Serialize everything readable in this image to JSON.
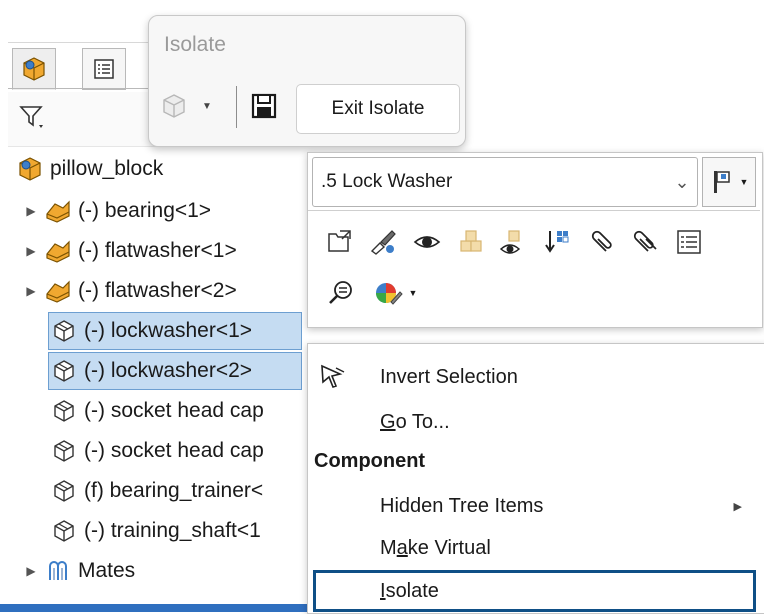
{
  "tree": {
    "root": {
      "label": "pillow_block",
      "icon": "assembly-icon"
    },
    "items": [
      {
        "label": "(-) bearing<1>",
        "icon": "subassembly-icon",
        "expandable": true,
        "selected": false
      },
      {
        "label": "(-) flatwasher<1>",
        "icon": "subassembly-icon",
        "expandable": true,
        "selected": false
      },
      {
        "label": "(-) flatwasher<2>",
        "icon": "subassembly-icon",
        "expandable": true,
        "selected": false
      },
      {
        "label": "(-) lockwasher<1>",
        "icon": "part-icon",
        "expandable": false,
        "selected": true
      },
      {
        "label": "(-) lockwasher<2>",
        "icon": "part-icon",
        "expandable": false,
        "selected": true
      },
      {
        "label": "(-) socket head cap",
        "icon": "part-icon",
        "expandable": false,
        "selected": false
      },
      {
        "label": "(-) socket head cap",
        "icon": "part-icon",
        "expandable": false,
        "selected": false
      },
      {
        "label": "(f) bearing_trainer<",
        "icon": "part-icon",
        "expandable": false,
        "selected": false
      },
      {
        "label": "(-) training_shaft<1",
        "icon": "part-icon",
        "expandable": false,
        "selected": false
      },
      {
        "label": "Mates",
        "icon": "mates-icon",
        "expandable": true,
        "selected": false
      }
    ]
  },
  "isolate_popup": {
    "title": "Isolate",
    "exit_label": "Exit Isolate"
  },
  "context_toolbar": {
    "selected_component": ".5 Lock Washer",
    "tools": [
      "open-part-icon",
      "edit-part-icon",
      "show-hide-eye-icon",
      "transparency-icon",
      "hide-others-icon",
      "insert-arrow-icon",
      "paperclip-icon",
      "multi-paperclip-icon",
      "properties-icon",
      "zoom-to-selection-icon",
      "appearance-icon"
    ]
  },
  "context_menu": {
    "invert_selection": "Invert Selection",
    "go_to": {
      "before": "",
      "key": "G",
      "after": "o To..."
    },
    "section_component": "Component",
    "hidden_tree_items": "Hidden Tree Items",
    "make_virtual": {
      "before": "M",
      "key": "a",
      "after": "ke Virtual"
    },
    "isolate": {
      "before": "",
      "key": "I",
      "after": "solate"
    }
  },
  "colors": {
    "selection_fill": "#c5dcf2",
    "selection_border": "#6d9fd1",
    "focus_outline": "#0f4f86",
    "assembly_orange": "#f0a830"
  }
}
